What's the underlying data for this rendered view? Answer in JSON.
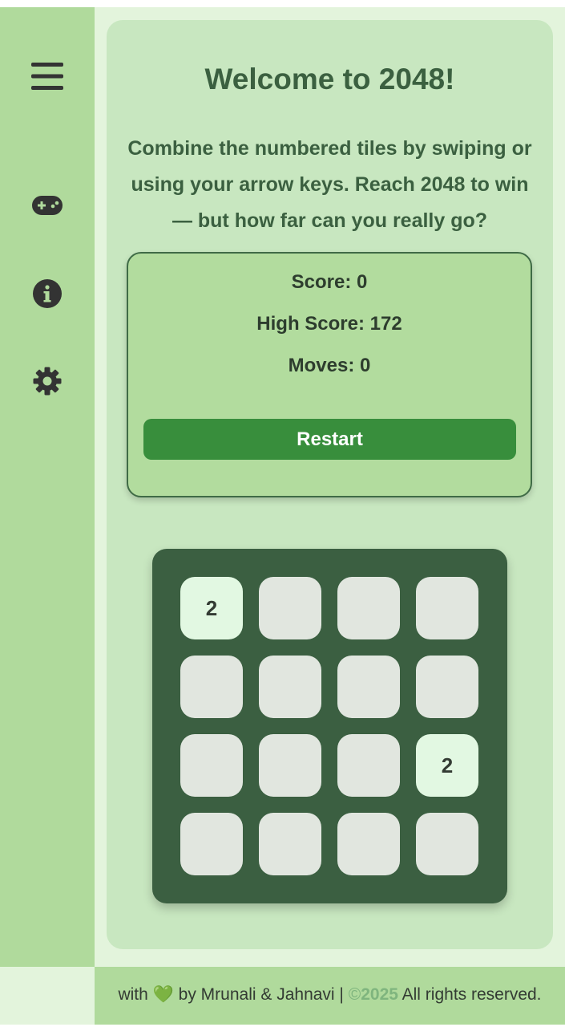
{
  "sidebar": {
    "items": [
      {
        "icon": "menu-icon"
      },
      {
        "icon": "gamepad-icon"
      },
      {
        "icon": "info-icon"
      },
      {
        "icon": "gear-icon"
      }
    ]
  },
  "main": {
    "title": "Welcome to 2048!",
    "intro": "Combine the numbered tiles by swiping or using your arrow keys. Reach 2048 to win — but how far can you really go?"
  },
  "stats": {
    "score_label": "Score: 0",
    "high_score_label": "High Score: 172",
    "moves_label": "Moves: 0",
    "restart_label": "Restart"
  },
  "board": {
    "rows": [
      [
        "2",
        "",
        "",
        ""
      ],
      [
        "",
        "",
        "",
        ""
      ],
      [
        "",
        "",
        "",
        "2"
      ],
      [
        "",
        "",
        "",
        ""
      ]
    ]
  },
  "footer": {
    "prefix": "with",
    "heart": "💚",
    "credit": "by Mrunali & Jahnavi |",
    "copyright_symbol": "©",
    "year": "2025",
    "rights": "All rights reserved."
  },
  "colors": {
    "sidebar": "#b0da9c",
    "card": "#c8e7c0",
    "board": "#3b5f41",
    "accent": "#388e3c",
    "title_text": "#3b6040"
  }
}
